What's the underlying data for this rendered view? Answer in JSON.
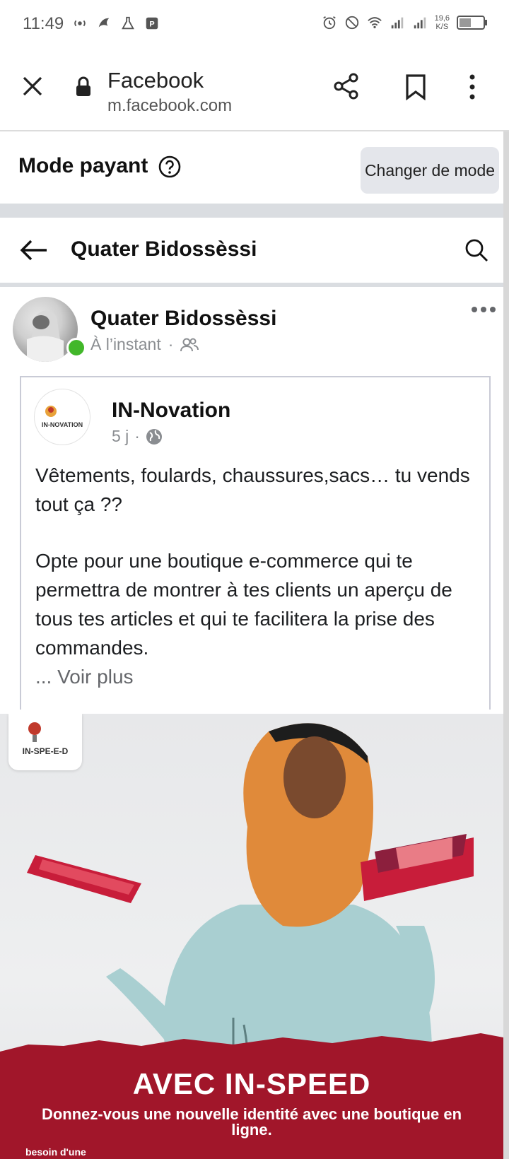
{
  "status_bar": {
    "time": "11:49",
    "speed_top": "19,6",
    "speed_bottom": "K/S"
  },
  "browser": {
    "site_name": "Facebook",
    "url": "m.facebook.com"
  },
  "pay_mode": {
    "title": "Mode payant",
    "change_button": "Changer de mode"
  },
  "page_header": {
    "title": "Quater Bidossèssi"
  },
  "post": {
    "author": "Quater Bidossèssi",
    "time": "À l’instant",
    "shared": {
      "author": "IN-Novation",
      "avatar_text": "IN-NOVATION",
      "time": "5 j",
      "paragraph1": "Vêtements, foulards, chaussures,sacs… tu vends tout ça ??",
      "paragraph2": "Opte pour une boutique e-commerce qui te permettra de montrer à tes clients un aperçu de tous tes articles et qui te facilitera la prise des commandes.",
      "see_more": "... Voir plus"
    }
  },
  "ad_image": {
    "logo_text": "IN-SPE-E-D",
    "headline": "AVEC IN-SPEED",
    "subline": "Donnez-vous une nouvelle identité avec une boutique en ligne.",
    "small_text": "besoin d'une"
  },
  "colors": {
    "online": "#42b72a",
    "ad_red": "#a1162a",
    "hijab": "#e08a3a",
    "dress": "#9fc7c9"
  }
}
